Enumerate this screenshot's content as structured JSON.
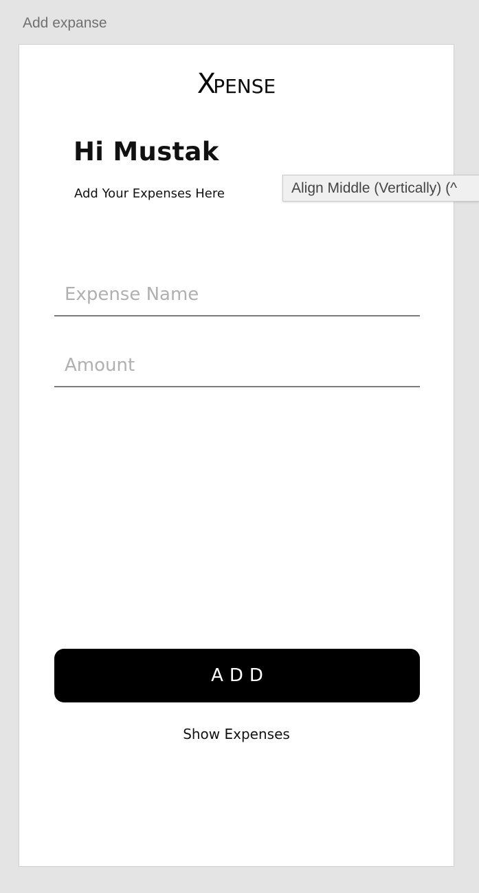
{
  "artboard": {
    "label": "Add expanse"
  },
  "app": {
    "logo_x": "X",
    "logo_rest": "PENSE",
    "greeting": "Hi Mustak",
    "subtitle": "Add Your Expenses Here"
  },
  "form": {
    "expense_name": {
      "value": "",
      "placeholder": "Expense Name"
    },
    "amount": {
      "value": "",
      "placeholder": "Amount"
    },
    "add_label": "ADD",
    "show_expenses_label": "Show Expenses"
  },
  "tooltip": {
    "text": "Align Middle (Vertically) (^"
  },
  "colors": {
    "canvas_background": "#e4e4e4",
    "artboard_background": "#ffffff",
    "button_background": "#000000",
    "button_text": "#ffffff",
    "placeholder": "#b0b0b0",
    "underline": "#7a7a7a",
    "tooltip_background": "#f0f0f0"
  }
}
